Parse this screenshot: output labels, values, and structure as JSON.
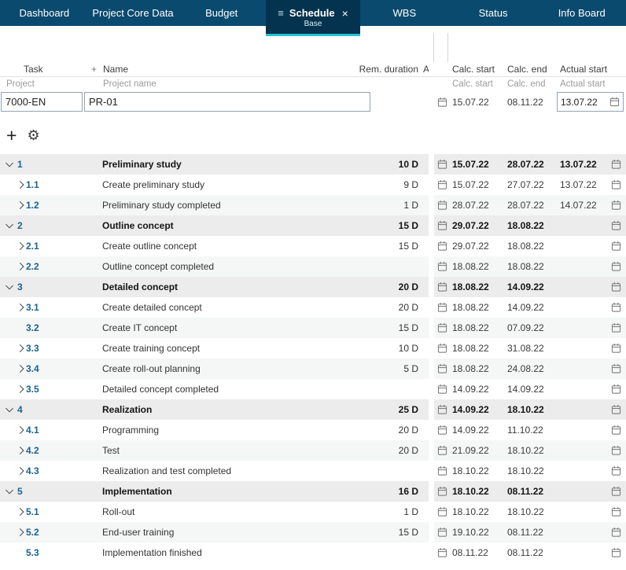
{
  "colors": {
    "nav_bar": "#0a4a6e",
    "active_tab": "#04334f",
    "accent_underline": "#2ac1d6",
    "task_number_blue": "#1a6390",
    "group_row_bg": "#ececec",
    "alt_row_bg": "#f5f6f6"
  },
  "icons": {
    "menu": "≡",
    "close": "×",
    "add": "+",
    "add_column": "+",
    "settings": "⚙"
  },
  "nav": {
    "tabs": [
      {
        "id": "dashboard",
        "label": "Dashboard",
        "active": false
      },
      {
        "id": "project-core-data",
        "label": "Project Core Data",
        "active": false
      },
      {
        "id": "budget",
        "label": "Budget",
        "active": false
      },
      {
        "id": "schedule",
        "label": "Schedule",
        "active": true,
        "sublabel": "Base"
      },
      {
        "id": "wbs",
        "label": "WBS",
        "active": false
      },
      {
        "id": "status",
        "label": "Status",
        "active": false
      },
      {
        "id": "info-board",
        "label": "Info Board",
        "active": false
      }
    ]
  },
  "headers": {
    "left": {
      "task": "Task",
      "name": "Name",
      "rem_duration": "Rem. duration",
      "truncated_next": "A"
    },
    "right": {
      "calc_start": "Calc. start",
      "calc_end": "Calc. end",
      "actual_start": "Actual start"
    },
    "sub_left": {
      "project": "Project",
      "project_name": "Project name"
    },
    "sub_right": {
      "calc_start": "Calc. start",
      "calc_end": "Calc. end",
      "actual_start": "Actual start"
    }
  },
  "project_row": {
    "id_value": "7000-EN",
    "name_value": "PR-01",
    "calc_start": "15.07.22",
    "calc_end": "08.11.22",
    "actual_start": "13.07.22"
  },
  "rows": [
    {
      "num": "1",
      "name": "Preliminary study",
      "duration": "10 D",
      "calc_start": "15.07.22",
      "calc_end": "28.07.22",
      "actual_start": "13.07.22",
      "group": true,
      "chevron": "down",
      "shade": "group"
    },
    {
      "num": "1.1",
      "name": "Create preliminary study",
      "duration": "9 D",
      "calc_start": "15.07.22",
      "calc_end": "27.07.22",
      "actual_start": "13.07.22",
      "group": false,
      "chevron": "right",
      "shade": "white"
    },
    {
      "num": "1.2",
      "name": "Preliminary study completed",
      "duration": "1 D",
      "calc_start": "28.07.22",
      "calc_end": "28.07.22",
      "actual_start": "14.07.22",
      "group": false,
      "chevron": "right",
      "shade": "gray"
    },
    {
      "num": "2",
      "name": "Outline concept",
      "duration": "15 D",
      "calc_start": "29.07.22",
      "calc_end": "18.08.22",
      "actual_start": "",
      "group": true,
      "chevron": "down",
      "shade": "group"
    },
    {
      "num": "2.1",
      "name": "Create outline concept",
      "duration": "15 D",
      "calc_start": "29.07.22",
      "calc_end": "18.08.22",
      "actual_start": "",
      "group": false,
      "chevron": "right",
      "shade": "white"
    },
    {
      "num": "2.2",
      "name": "Outline concept completed",
      "duration": "",
      "calc_start": "18.08.22",
      "calc_end": "18.08.22",
      "actual_start": "",
      "group": false,
      "chevron": "right",
      "shade": "gray"
    },
    {
      "num": "3",
      "name": "Detailed concept",
      "duration": "20 D",
      "calc_start": "18.08.22",
      "calc_end": "14.09.22",
      "actual_start": "",
      "group": true,
      "chevron": "down",
      "shade": "group"
    },
    {
      "num": "3.1",
      "name": "Create detailed concept",
      "duration": "20 D",
      "calc_start": "18.08.22",
      "calc_end": "14.09.22",
      "actual_start": "",
      "group": false,
      "chevron": "right",
      "shade": "white"
    },
    {
      "num": "3.2",
      "name": "Create IT concept",
      "duration": "15 D",
      "calc_start": "18.08.22",
      "calc_end": "07.09.22",
      "actual_start": "",
      "group": false,
      "chevron": "none",
      "shade": "gray"
    },
    {
      "num": "3.3",
      "name": "Create training concept",
      "duration": "10 D",
      "calc_start": "18.08.22",
      "calc_end": "31.08.22",
      "actual_start": "",
      "group": false,
      "chevron": "right",
      "shade": "white"
    },
    {
      "num": "3.4",
      "name": "Create roll-out planning",
      "duration": "5 D",
      "calc_start": "18.08.22",
      "calc_end": "24.08.22",
      "actual_start": "",
      "group": false,
      "chevron": "right",
      "shade": "gray"
    },
    {
      "num": "3.5",
      "name": "Detailed concept completed",
      "duration": "",
      "calc_start": "14.09.22",
      "calc_end": "14.09.22",
      "actual_start": "",
      "group": false,
      "chevron": "right",
      "shade": "white"
    },
    {
      "num": "4",
      "name": "Realization",
      "duration": "25 D",
      "calc_start": "14.09.22",
      "calc_end": "18.10.22",
      "actual_start": "",
      "group": true,
      "chevron": "down",
      "shade": "group"
    },
    {
      "num": "4.1",
      "name": "Programming",
      "duration": "20 D",
      "calc_start": "14.09.22",
      "calc_end": "11.10.22",
      "actual_start": "",
      "group": false,
      "chevron": "right",
      "shade": "white"
    },
    {
      "num": "4.2",
      "name": "Test",
      "duration": "20 D",
      "calc_start": "21.09.22",
      "calc_end": "18.10.22",
      "actual_start": "",
      "group": false,
      "chevron": "right",
      "shade": "gray"
    },
    {
      "num": "4.3",
      "name": "Realization and test completed",
      "duration": "",
      "calc_start": "18.10.22",
      "calc_end": "18.10.22",
      "actual_start": "",
      "group": false,
      "chevron": "right",
      "shade": "white"
    },
    {
      "num": "5",
      "name": "Implementation",
      "duration": "16 D",
      "calc_start": "18.10.22",
      "calc_end": "08.11.22",
      "actual_start": "",
      "group": true,
      "chevron": "down",
      "shade": "group"
    },
    {
      "num": "5.1",
      "name": "Roll-out",
      "duration": "1 D",
      "calc_start": "18.10.22",
      "calc_end": "18.10.22",
      "actual_start": "",
      "group": false,
      "chevron": "right",
      "shade": "white"
    },
    {
      "num": "5.2",
      "name": "End-user training",
      "duration": "15 D",
      "calc_start": "19.10.22",
      "calc_end": "08.11.22",
      "actual_start": "",
      "group": false,
      "chevron": "right",
      "shade": "gray"
    },
    {
      "num": "5.3",
      "name": "Implementation finished",
      "duration": "",
      "calc_start": "08.11.22",
      "calc_end": "08.11.22",
      "actual_start": "",
      "group": false,
      "chevron": "none",
      "shade": "white"
    }
  ]
}
